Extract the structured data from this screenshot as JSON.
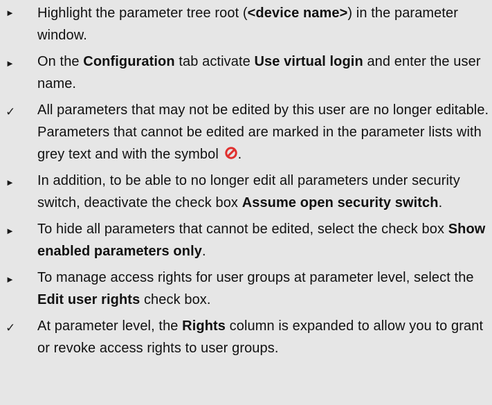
{
  "steps": [
    {
      "marker": "►",
      "marker_kind": "action",
      "parts": [
        {
          "text": "Highlight the parameter tree root ("
        },
        {
          "text": "<device name>",
          "bold": true
        },
        {
          "text": ") in the parameter window."
        }
      ]
    },
    {
      "marker": "►",
      "marker_kind": "action",
      "parts": [
        {
          "text": "On the "
        },
        {
          "text": "Configuration",
          "bold": true
        },
        {
          "text": " tab activate "
        },
        {
          "text": "Use virtual login",
          "bold": true
        },
        {
          "text": " and enter the user name."
        }
      ]
    },
    {
      "marker": "✓",
      "marker_kind": "result",
      "parts": [
        {
          "text": "All parameters that may not be edited by this user are no longer editable."
        },
        {
          "break": true
        },
        {
          "text": "Parameters that cannot be edited are marked in the parameter lists with grey text and with the symbol "
        },
        {
          "icon": "forbidden-icon"
        },
        {
          "text": "."
        }
      ]
    },
    {
      "marker": "►",
      "marker_kind": "action",
      "parts": [
        {
          "text": "In addition, to be able to no longer edit all parameters under security switch, deactivate the check box "
        },
        {
          "text": "Assume open security switch",
          "bold": true
        },
        {
          "text": "."
        }
      ]
    },
    {
      "marker": "►",
      "marker_kind": "action",
      "parts": [
        {
          "text": "To hide all parameters that cannot be edited, select the check box "
        },
        {
          "text": "Show enabled parameters only",
          "bold": true
        },
        {
          "text": "."
        }
      ]
    },
    {
      "marker": "►",
      "marker_kind": "action",
      "parts": [
        {
          "text": "To manage access rights for user groups at parameter level, select the "
        },
        {
          "text": "Edit user rights",
          "bold": true
        },
        {
          "text": " check box."
        }
      ]
    },
    {
      "marker": "✓",
      "marker_kind": "result",
      "parts": [
        {
          "text": "At parameter level, the "
        },
        {
          "text": "Rights",
          "bold": true
        },
        {
          "text": " column is expanded to allow you to grant or revoke access rights to user groups."
        }
      ]
    }
  ],
  "colors": {
    "background": "#e6e6e6",
    "text": "#111111",
    "forbidden_icon": "#e0302e"
  }
}
